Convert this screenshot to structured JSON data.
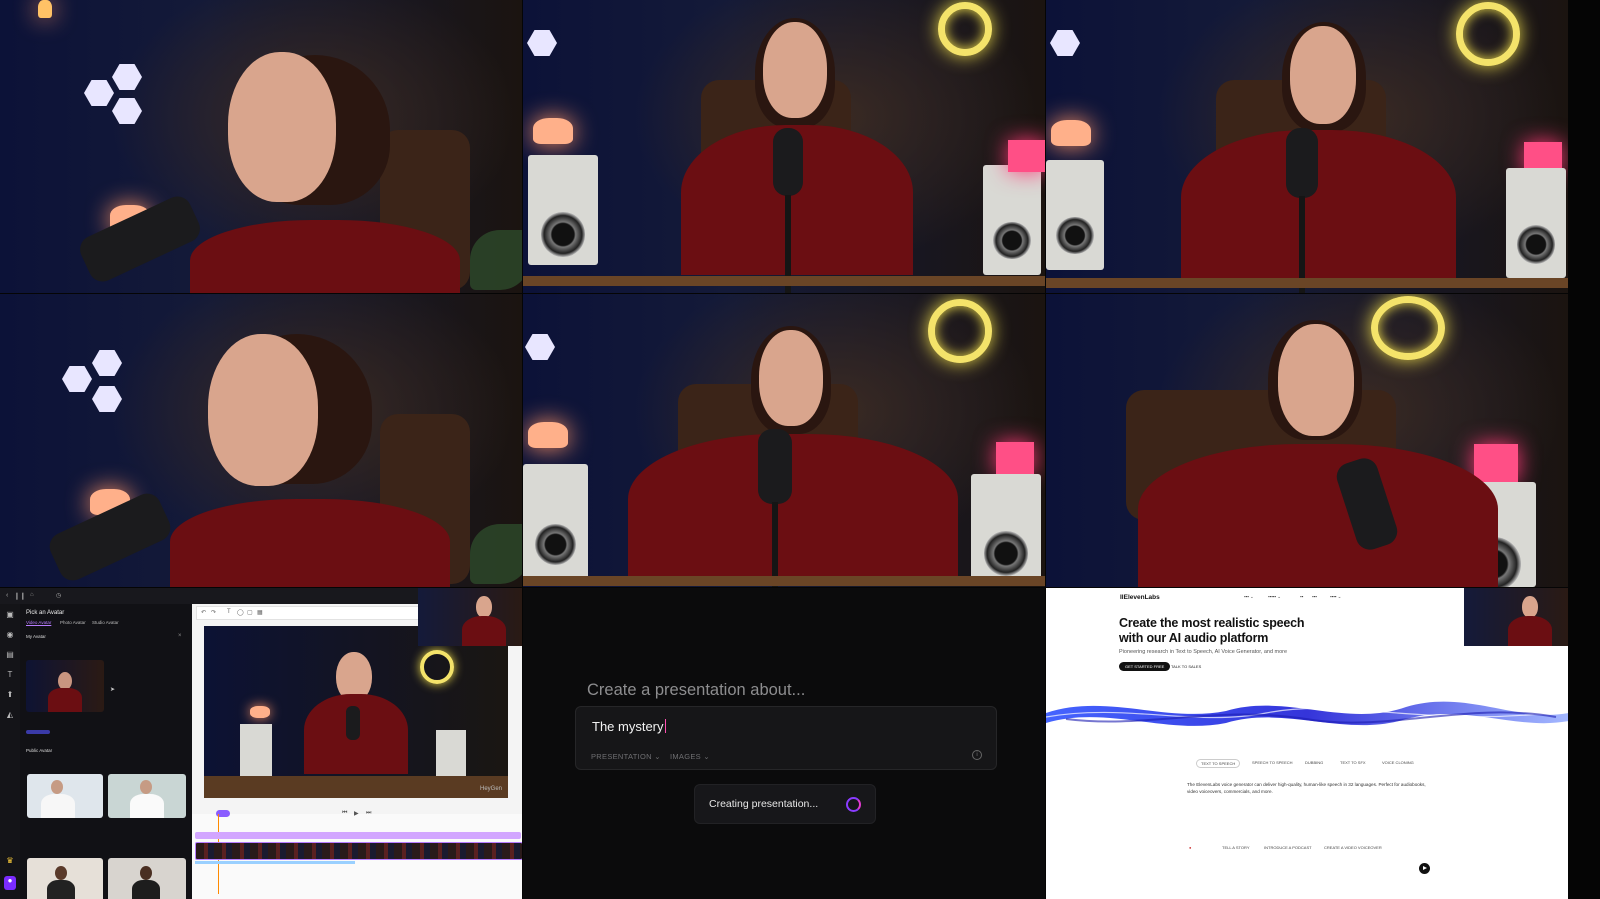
{
  "presentation": {
    "heading": "Create a presentation about...",
    "input_value": "The mystery",
    "option_presentation": "PRESENTATION",
    "option_images": "IMAGES",
    "info_icon": "info-icon",
    "status_text": "Creating presentation...",
    "spinner_colors": [
      "#8a3cff",
      "#e23bd1"
    ]
  },
  "editor": {
    "panel_title": "Pick an Avatar",
    "tabs": [
      "Video Avatar",
      "Photo Avatar",
      "Studio Avatar"
    ],
    "my_avatar_label": "My Avatar",
    "public_avatar_label": "Public Avatar",
    "watermark": "HeyGen",
    "accent": "#b77cff"
  },
  "elevenlabs": {
    "logo": "IIElevenLabs",
    "headline_line1": "Create the most realistic speech",
    "headline_line2": "with our AI audio platform",
    "subline": "Pioneering research in Text to Speech, AI Voice Generator, and more",
    "primary_button": "GET STARTED FREE",
    "secondary_button": "TALK TO SALES",
    "tabs": [
      "TEXT TO SPEECH",
      "SPEECH TO SPEECH",
      "DUBBING",
      "TEXT TO SFX",
      "VOICE CLONING"
    ],
    "paragraph": "The ElevenLabs voice generator can deliver high-quality, human-like speech in 32 languages. Perfect for audiobooks, video voiceovers, commercials, and more.",
    "footer_items": [
      "TELL A STORY",
      "INTRODUCE A PODCAST",
      "CREATE A VIDEO VOICEOVER"
    ],
    "wave_color": "#2a3cf0"
  }
}
